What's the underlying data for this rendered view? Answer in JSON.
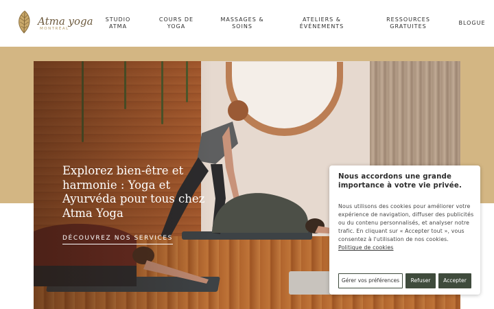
{
  "header": {
    "logo_text": "Atma yoga",
    "logo_subtext": "MONTRÉAL",
    "nav": [
      {
        "line1": "STUDIO",
        "line2": "ATMA"
      },
      {
        "line1": "COURS DE",
        "line2": "YOGA"
      },
      {
        "line1": "MASSAGES &",
        "line2": "SOINS"
      },
      {
        "line1": "ATELIERS &",
        "line2": "ÉVÉNEMENTS"
      },
      {
        "line1": "RESSOURCES",
        "line2": "GRATUITES"
      },
      {
        "line1": "BLOGUE",
        "line2": ""
      }
    ]
  },
  "hero": {
    "title": "Explorez bien-être et harmonie : Yoga et Ayurvéda pour tous chez Atma Yoga",
    "cta": "DÉCOUVREZ NOS SERVICES"
  },
  "cookie": {
    "title": "Nous accordons une grande importance à votre vie privée.",
    "body": "Nous utilisons des cookies pour améliorer votre expérience de navigation, diffuser des publicités ou du contenu personnalisés, et analyser notre trafic. En cliquant sur « Accepter tout », vous consentez à l'utilisation de nos cookies.",
    "link": "Politique de cookies",
    "buttons": {
      "manage": "Gérer vos préférences",
      "refuse": "Refuser",
      "accept": "Accepter"
    }
  },
  "colors": {
    "band": "#d3b683",
    "button_dark": "#3f4b3c",
    "logo_brown": "#6d5a3e"
  },
  "icons": {
    "logo": "leaf-icon"
  }
}
